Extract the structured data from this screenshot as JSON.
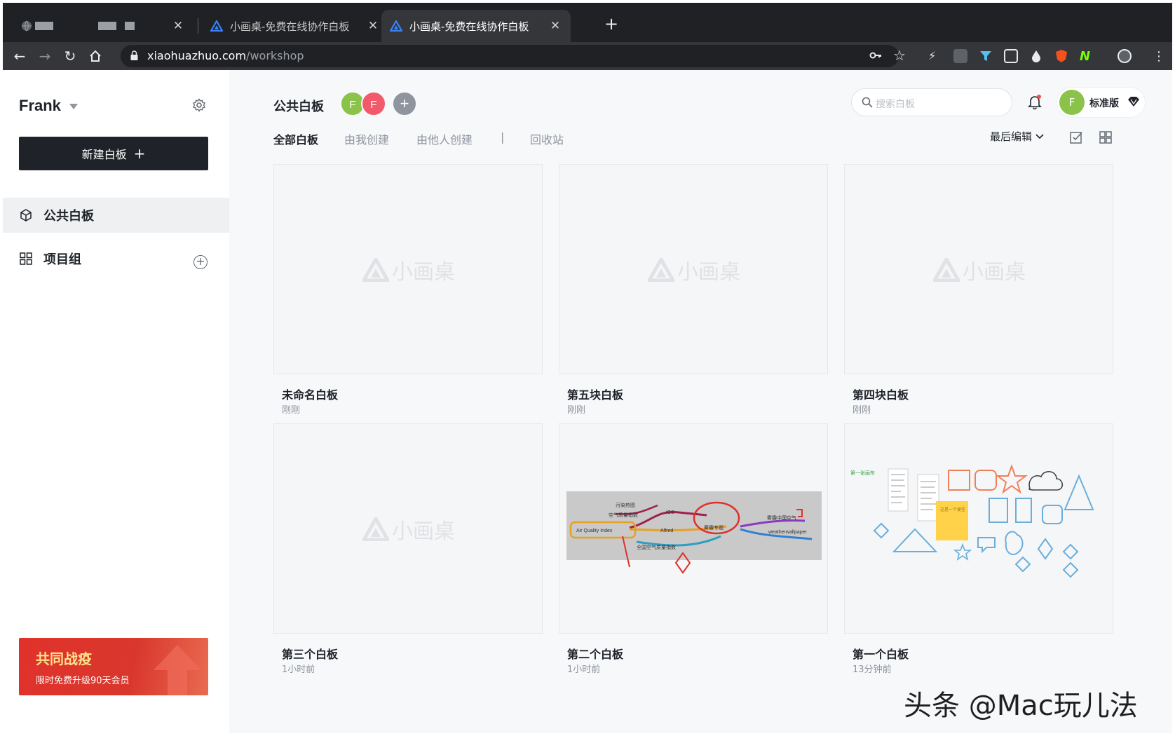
{
  "browser": {
    "tabs": [
      {
        "title": "",
        "active": false
      },
      {
        "title": "小画桌-免费在线协作白板",
        "active": false
      },
      {
        "title": "小画桌-免费在线协作白板",
        "active": true
      }
    ],
    "url_host": "xiaohuazhuo.com",
    "url_path": "/workshop"
  },
  "sidebar": {
    "user_name": "Frank",
    "new_board_label": "新建白板",
    "items": [
      {
        "label": "公共白板",
        "icon": "cube-icon",
        "active": true
      },
      {
        "label": "项目组",
        "icon": "grid-icon",
        "active": false
      }
    ],
    "promo": {
      "title": "共同战疫",
      "subtitle": "限时免费升级90天会员"
    }
  },
  "header": {
    "title": "公共白板",
    "avatars": [
      {
        "letter": "F",
        "color": "#8bc34a"
      },
      {
        "letter": "F",
        "color": "#f25a6b"
      }
    ],
    "add_member_symbol": "+",
    "search_placeholder": "搜索白板",
    "plan": {
      "avatar_letter": "F",
      "label": "标准版"
    },
    "tabs": [
      {
        "label": "全部白板",
        "active": true
      },
      {
        "label": "由我创建",
        "active": false
      },
      {
        "label": "由他人创建",
        "active": false
      },
      {
        "label": "|",
        "active": false
      },
      {
        "label": "回收站",
        "active": false
      }
    ],
    "sort_label": "最后编辑"
  },
  "watermark_label": "小画桌",
  "boards": [
    {
      "name": "未命名白板",
      "time": "刚刚",
      "thumb": "empty"
    },
    {
      "name": "第五块白板",
      "time": "刚刚",
      "thumb": "empty"
    },
    {
      "name": "第四块白板",
      "time": "刚刚",
      "thumb": "empty"
    },
    {
      "name": "第三个白板",
      "time": "1小时前",
      "thumb": "empty"
    },
    {
      "name": "第二个白板",
      "time": "1小时前",
      "thumb": "mindmap"
    },
    {
      "name": "第一个白板",
      "time": "13分钟前",
      "thumb": "shapes"
    }
  ],
  "mindmap_labels": {
    "n1": "污染热图",
    "n2": "空气质量指数",
    "n3": "iOS",
    "n4": "Air Quality Index",
    "n5": "Alfred",
    "n6": "全国空气质量指数",
    "n7": "雾霾专题",
    "n8": "雾霾中国空气",
    "n9": "weatherwallpaper"
  },
  "shapes_label": "第一张画布",
  "sticky_label": "这是一个便签",
  "overlay_watermark": "头条 @Mac玩儿法",
  "colors": {
    "accent_dark": "#1f2329",
    "promo_red": "#e0322b",
    "avatar_green": "#8bc34a",
    "avatar_red": "#f25a6b",
    "shape_orange": "#f0805a",
    "shape_blue": "#6aaedc"
  }
}
